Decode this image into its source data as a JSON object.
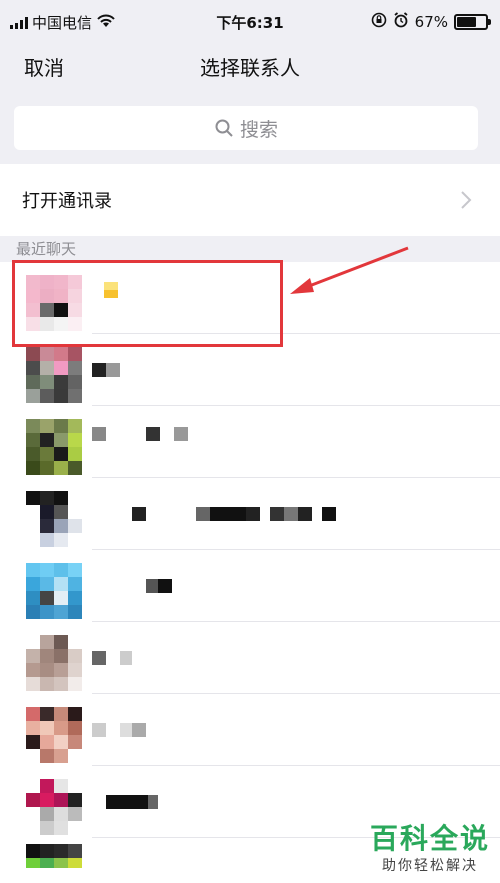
{
  "status_bar": {
    "carrier": "中国电信",
    "time": "下午6:31",
    "battery": "67%",
    "battery_level": 0.67
  },
  "nav": {
    "cancel_label": "取消",
    "title": "选择联系人"
  },
  "search": {
    "placeholder": "搜索"
  },
  "open_contacts_label": "打开通讯录",
  "section_recent_chats": "最近聊天",
  "watermark": {
    "title": "百科全说",
    "subtitle": "助你轻松解决"
  },
  "colors": {
    "accent_highlight": "#e2373b",
    "watermark_green": "#2aa85b",
    "background_gray": "#efeff4"
  },
  "icons": [
    "wifi-icon",
    "orientation-lock-icon",
    "alarm-icon",
    "battery-icon",
    "search-icon",
    "chevron-right-icon"
  ]
}
